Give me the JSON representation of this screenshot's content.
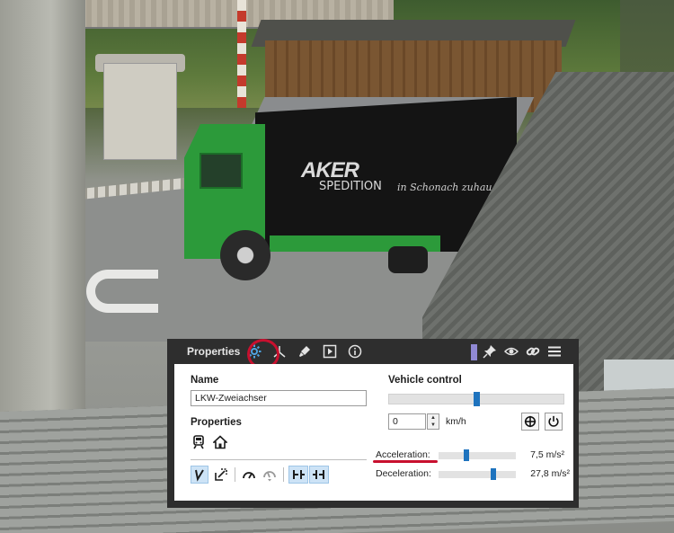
{
  "scene": {
    "truck_logo": "AKER",
    "truck_logo_sub": "SPEDITION",
    "truck_slogan": "in Schonach zuhau"
  },
  "panel": {
    "title": "Properties",
    "header_icons": [
      "gear-icon",
      "axis-icon",
      "brush-icon",
      "play-icon",
      "info-icon"
    ],
    "header_right_icons": [
      "pin-icon",
      "eye-icon",
      "link-icon",
      "menu-icon"
    ],
    "name_label": "Name",
    "name_value": "LKW-Zweiachser",
    "properties_label": "Properties",
    "property_icons": [
      "train-icon",
      "home-icon"
    ],
    "tool_icons": [
      "cursor-icon",
      "crop-icon",
      "gauge-icon",
      "gauge-disabled-icon",
      "coupling-left-icon",
      "coupling-right-icon"
    ]
  },
  "vehicle_control": {
    "title": "Vehicle control",
    "speed_slider_level": 0.5,
    "speed_value": "0",
    "speed_unit": "km/h",
    "acceleration_label": "Acceleration:",
    "acceleration_value": "7,5 m/s²",
    "acceleration_level": 0.35,
    "deceleration_label": "Deceleration:",
    "deceleration_value": "27,8 m/s²",
    "deceleration_level": 0.72
  },
  "colors": {
    "panel_bg": "#2e2e2e",
    "accent_blue": "#1e73be",
    "highlight_red": "#c8102e"
  }
}
